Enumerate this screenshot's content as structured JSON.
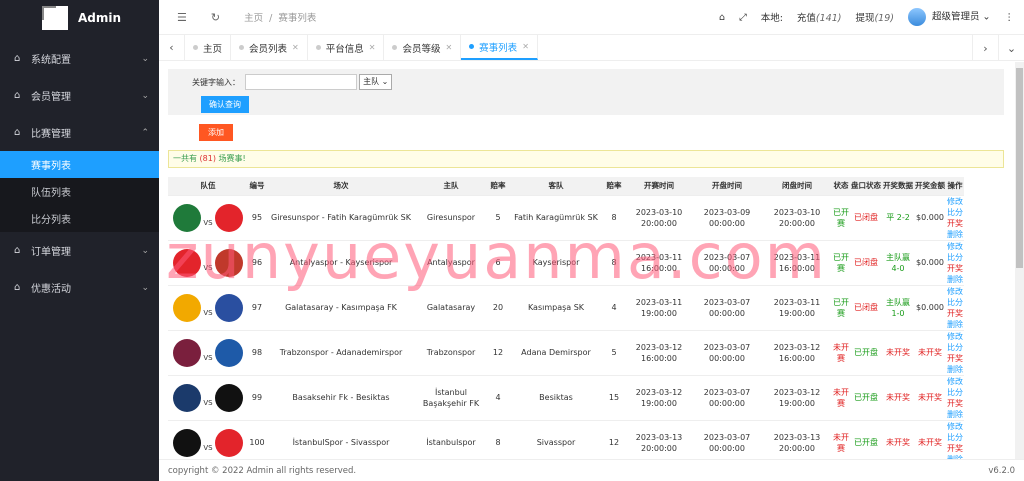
{
  "brand": {
    "title": "Admin"
  },
  "sidebar": {
    "items": [
      {
        "label": "系统配置",
        "icon": "home-icon"
      },
      {
        "label": "会员管理",
        "icon": "home-icon"
      },
      {
        "label": "比赛管理",
        "icon": "home-icon",
        "open": true,
        "children": [
          "赛事列表",
          "队伍列表",
          "比分列表"
        ]
      },
      {
        "label": "订单管理",
        "icon": "home-icon"
      },
      {
        "label": "优惠活动",
        "icon": "home-icon"
      }
    ]
  },
  "topbar": {
    "breadcrumb_home": "主页",
    "breadcrumb_current": "赛事列表",
    "local_label": "本地:",
    "recharge_label": "充值",
    "recharge_count": "(141)",
    "withdraw_label": "提现",
    "withdraw_count": "(19)",
    "user": "超级管理员"
  },
  "tabs": [
    "主页",
    "会员列表",
    "平台信息",
    "会员等级",
    "赛事列表"
  ],
  "search": {
    "keyword_label": "关键字输入：",
    "keyword_value": "",
    "select_value": "主队",
    "query_button": "确认查询",
    "add_button": "添加"
  },
  "notice": {
    "prefix": "一共有",
    "count": "(81)",
    "suffix": "场赛事!"
  },
  "table": {
    "headers": [
      "队伍",
      "编号",
      "场次",
      "主队",
      "赔率",
      "客队",
      "赔率",
      "开赛时间",
      "开盘时间",
      "闭盘时间",
      "状态",
      "盘口状态",
      "开奖数据",
      "开奖金额",
      "操作"
    ],
    "rows": [
      {
        "id": "95",
        "match": "Giresunspor - Fatih Karagümrük SK",
        "home": "Giresunspor",
        "home_odds": "5",
        "away": "Fatih Karagümrük SK",
        "away_odds": "8",
        "start": "2023-03-10 20:00:00",
        "open": "2023-03-09 00:00:00",
        "close": "2023-03-10 20:00:00",
        "status": "已开赛",
        "market": "已闭盘",
        "result": "平 2-2",
        "amount": "$0.000",
        "c1": "#1f7a3a",
        "c2": "#e3242b"
      },
      {
        "id": "96",
        "match": "Antalyaspor - Kayserispor",
        "home": "Antalyaspor",
        "home_odds": "6",
        "away": "Kayserispor",
        "away_odds": "8",
        "start": "2023-03-11 16:00:00",
        "open": "2023-03-07 00:00:00",
        "close": "2023-03-11 16:00:00",
        "status": "已开赛",
        "market": "已闭盘",
        "result": "主队赢 4-0",
        "amount": "$0.000",
        "c1": "#e3242b",
        "c2": "#c0392b"
      },
      {
        "id": "97",
        "match": "Galatasaray - Kasımpaşa FK",
        "home": "Galatasaray",
        "home_odds": "20",
        "away": "Kasımpaşa SK",
        "away_odds": "4",
        "start": "2023-03-11 19:00:00",
        "open": "2023-03-07 00:00:00",
        "close": "2023-03-11 19:00:00",
        "status": "已开赛",
        "market": "已闭盘",
        "result": "主队赢 1-0",
        "amount": "$0.000",
        "c1": "#f2a900",
        "c2": "#2a4fa0"
      },
      {
        "id": "98",
        "match": "Trabzonspor - Adanademirspor",
        "home": "Trabzonspor",
        "home_odds": "12",
        "away": "Adana Demirspor",
        "away_odds": "5",
        "start": "2023-03-12 16:00:00",
        "open": "2023-03-07 00:00:00",
        "close": "2023-03-12 16:00:00",
        "status": "未开赛",
        "market": "已开盘",
        "result": "未开奖",
        "amount": "未开奖",
        "c1": "#7a1f3d",
        "c2": "#1e5aa8"
      },
      {
        "id": "99",
        "match": "Basaksehir Fk - Besiktas",
        "home": "İstanbul Başakşehir FK",
        "home_odds": "4",
        "away": "Besiktas",
        "away_odds": "15",
        "start": "2023-03-12 19:00:00",
        "open": "2023-03-07 00:00:00",
        "close": "2023-03-12 19:00:00",
        "status": "未开赛",
        "market": "已开盘",
        "result": "未开奖",
        "amount": "未开奖",
        "c1": "#1b3a6b",
        "c2": "#111111"
      },
      {
        "id": "100",
        "match": "İstanbulSpor - Sivasspor",
        "home": "İstanbulspor",
        "home_odds": "8",
        "away": "Sivasspor",
        "away_odds": "12",
        "start": "2023-03-13 20:00:00",
        "open": "2023-03-07 00:00:00",
        "close": "2023-03-13 20:00:00",
        "status": "未开赛",
        "market": "已开盘",
        "result": "未开奖",
        "amount": "未开奖",
        "c1": "#111111",
        "c2": "#e3242b"
      }
    ],
    "ops": {
      "edit": "修改",
      "score": "比分",
      "draw": "开奖",
      "delete": "删除"
    }
  },
  "footer": {
    "copyright": "copyright © 2022 Admin all rights reserved.",
    "version": "v6.2.0"
  },
  "watermark": "zunyueyuanma.com"
}
